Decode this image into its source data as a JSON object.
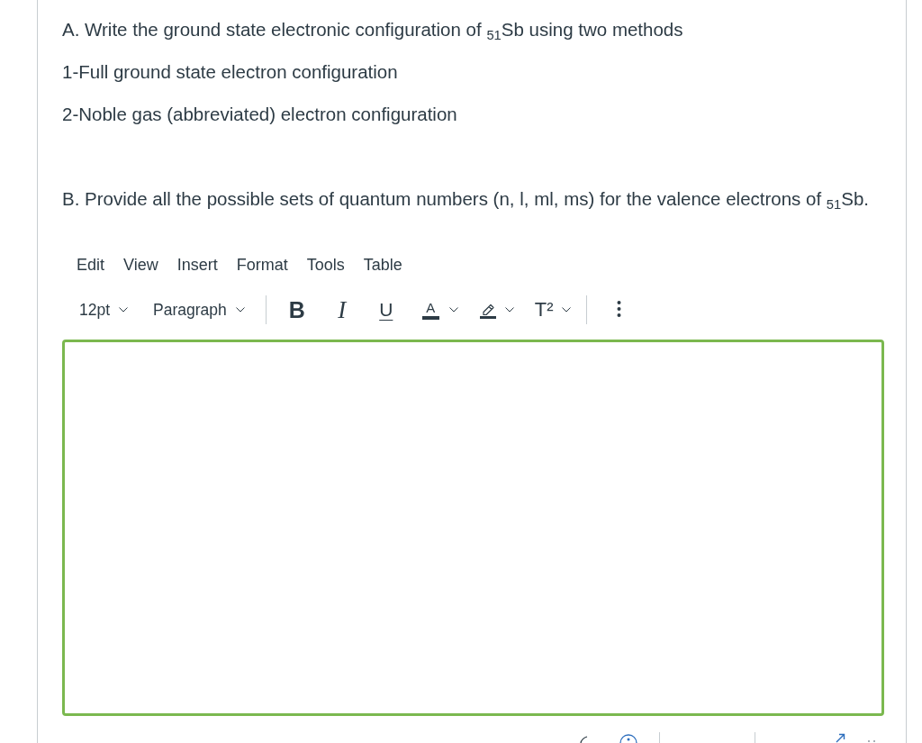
{
  "question": {
    "part_a": {
      "text": "A. Write the ground state electronic configuration of $_{51}$Sb using two methods",
      "steps": [
        "1-Full ground state electron configuration",
        "2-Noble gas (abbreviated) electron configuration"
      ]
    },
    "part_b": {
      "text": "B. Provide all the possible sets of quantum numbers (n, l, ml, ms) for the valence electrons of $_{51}$Sb."
    }
  },
  "editor": {
    "menu": [
      "Edit",
      "View",
      "Insert",
      "Format",
      "Tools",
      "Table"
    ],
    "toolbar": [
      [
        {
          "kind": "select",
          "label": "12pt",
          "dropdown": true
        },
        {
          "kind": "select",
          "label": "Paragraph",
          "dropdown": true
        }
      ],
      [
        {
          "kind": "bold",
          "label": "B",
          "dropdown": false
        },
        {
          "kind": "italic",
          "label": "I",
          "dropdown": false
        },
        {
          "kind": "underline",
          "label": "U",
          "dropdown": false
        },
        {
          "kind": "text-color",
          "label": "A",
          "dropdown": true
        },
        {
          "kind": "highlight",
          "dropdown": true
        },
        {
          "kind": "superscript",
          "label": "T²",
          "dropdown": true
        }
      ],
      [
        {
          "kind": "more",
          "dropdown": false
        }
      ]
    ],
    "body": {
      "focused": true
    }
  }
}
